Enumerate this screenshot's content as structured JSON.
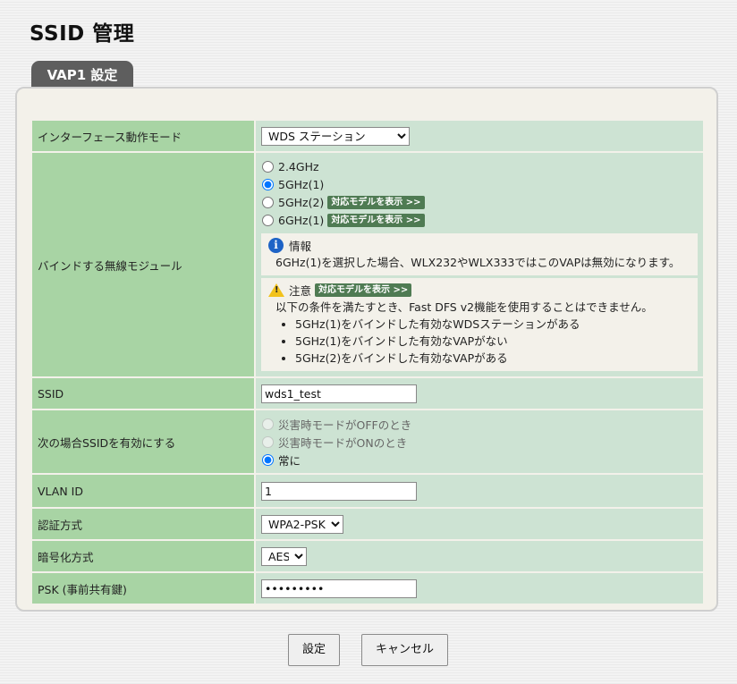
{
  "page": {
    "title": "SSID 管理"
  },
  "tab": {
    "label": "VAP1 設定"
  },
  "rows": {
    "interface_mode": {
      "label": "インターフェース動作モード",
      "value": "WDS ステーション"
    },
    "bind_module": {
      "label": "バインドする無線モジュール",
      "options": [
        {
          "label": "2.4GHz",
          "checked": false,
          "badge": ""
        },
        {
          "label": "5GHz(1)",
          "checked": true,
          "badge": ""
        },
        {
          "label": "5GHz(2)",
          "checked": false,
          "badge": "対応モデルを表示 >>"
        },
        {
          "label": "6GHz(1)",
          "checked": false,
          "badge": "対応モデルを表示 >>"
        }
      ],
      "info": {
        "title": "情報",
        "text": "6GHz(1)を選択した場合、WLX232やWLX333ではこのVAPは無効になります。"
      },
      "caution": {
        "title": "注意",
        "badge": "対応モデルを表示 >>",
        "text": "以下の条件を満たすとき、Fast DFS v2機能を使用することはできません。",
        "items": [
          "5GHz(1)をバインドした有効なWDSステーションがある",
          "5GHz(1)をバインドした有効なVAPがない",
          "5GHz(2)をバインドした有効なVAPがある"
        ]
      }
    },
    "ssid": {
      "label": "SSID",
      "value": "wds1_test"
    },
    "enable_ssid": {
      "label": "次の場合SSIDを有効にする",
      "options": [
        {
          "label": "災害時モードがOFFのとき",
          "checked": false,
          "disabled": true
        },
        {
          "label": "災害時モードがONのとき",
          "checked": false,
          "disabled": true
        },
        {
          "label": "常に",
          "checked": true,
          "disabled": false
        }
      ]
    },
    "vlan_id": {
      "label": "VLAN ID",
      "value": "1"
    },
    "auth": {
      "label": "認証方式",
      "value": "WPA2-PSK"
    },
    "encryption": {
      "label": "暗号化方式",
      "value": "AES"
    },
    "psk": {
      "label": "PSK (事前共有鍵)",
      "value": "•••••••••"
    }
  },
  "buttons": {
    "save": "設定",
    "cancel": "キャンセル"
  }
}
